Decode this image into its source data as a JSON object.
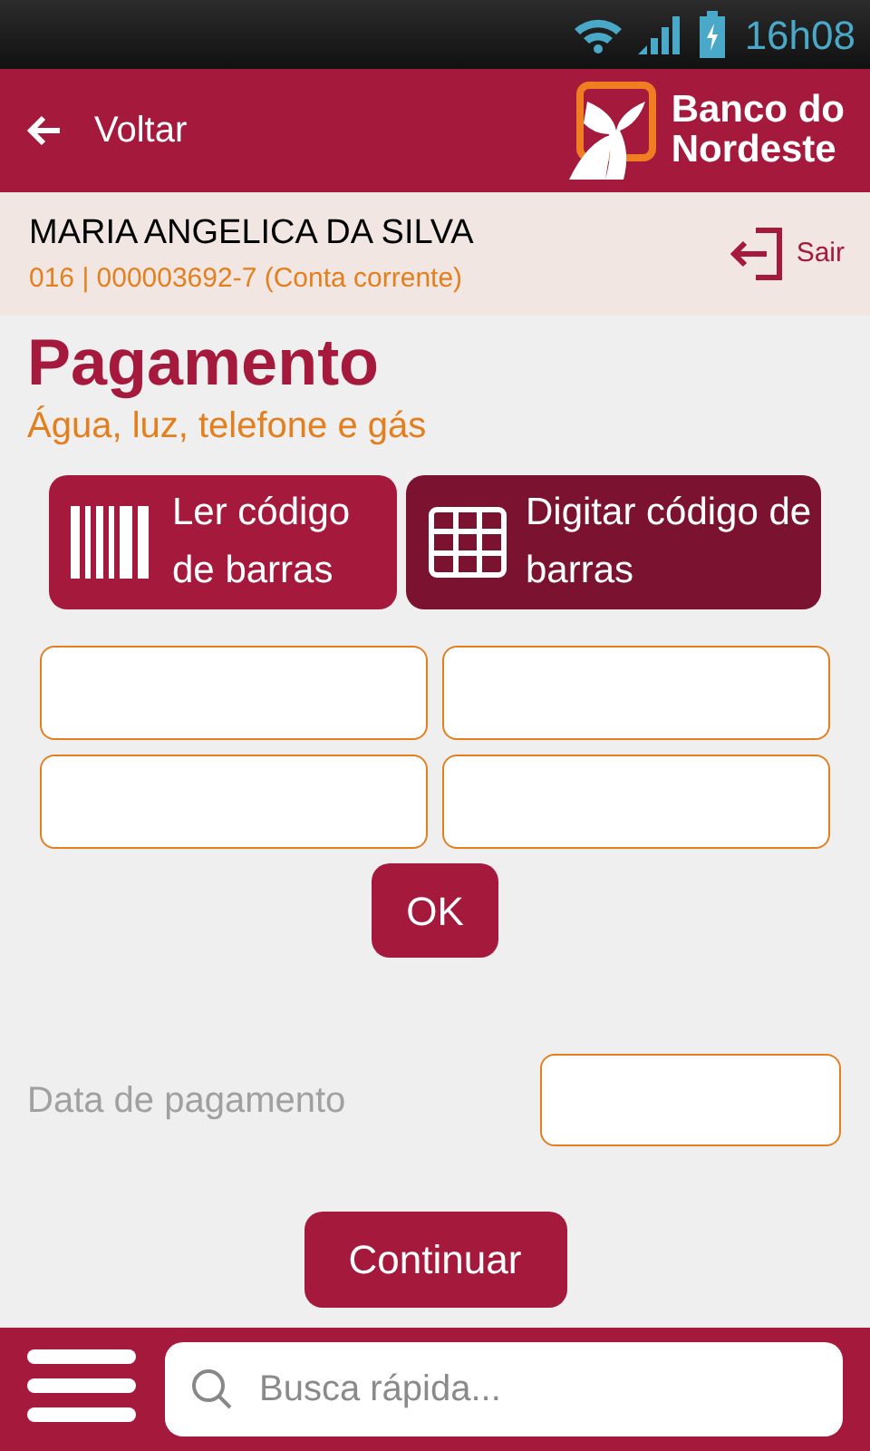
{
  "status_bar": {
    "time": "16h08"
  },
  "header": {
    "back_label": "Voltar",
    "logo_text": [
      "Banco do",
      "Nordeste"
    ]
  },
  "account": {
    "name": "MARIA ANGELICA DA SILVA",
    "detail": "016 | 000003692-7 (Conta corrente)",
    "logout_label": "Sair"
  },
  "page": {
    "title": "Pagamento",
    "subtitle": "Água, luz, telefone e gás"
  },
  "modes": [
    {
      "kind": "barcode",
      "label": "Ler código de barras",
      "selected": false
    },
    {
      "kind": "grid",
      "label": "Digitar código de barras",
      "selected": true
    }
  ],
  "ok_button": "OK",
  "date": {
    "label": "Data de pagamento"
  },
  "continue_button": "Continuar",
  "search": {
    "placeholder": "Busca rápida..."
  }
}
